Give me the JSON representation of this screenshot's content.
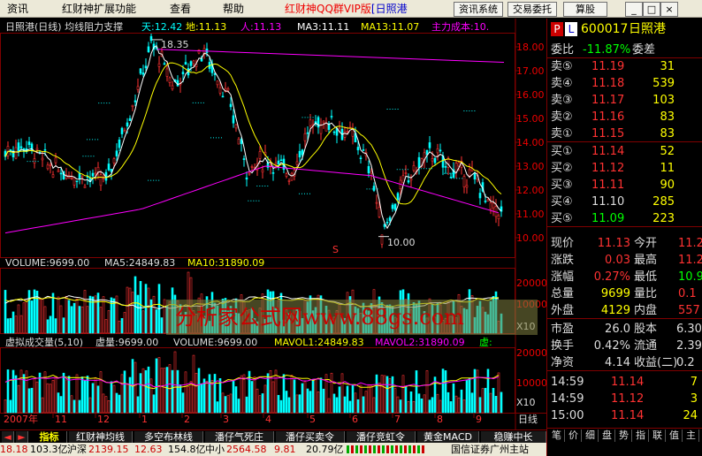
{
  "menu": {
    "items": [
      "资讯",
      "红财神扩展功能",
      "查看",
      "帮助"
    ],
    "brand": "红财神QQ群VIP版",
    "stock_tag": "[日照港"
  },
  "toolbar": {
    "news_system": "资讯系统",
    "trade": "交易委托",
    "calc": "算股",
    "f10": "F10",
    "minimize": "_",
    "maximize": "□",
    "close": "×"
  },
  "price_chart": {
    "title": "日照港(日线) 均线阻力支撑",
    "tian": "天:12.42",
    "di": "地:11.13",
    "ren": "人:11.13",
    "ma3": "MA3:11.11",
    "ma13": "MA13:11.07",
    "cost": "主力成本:10.",
    "high_label": "18.35",
    "low_label": "10.00",
    "marker": "S",
    "yticks": [
      "18.00",
      "17.00",
      "16.00",
      "15.00",
      "14.00",
      "13.00",
      "12.00",
      "11.00",
      "10.00"
    ]
  },
  "volume_chart": {
    "volume": "VOLUME:9699.00",
    "ma5": "MA5:24849.83",
    "ma10": "MA10:31890.09",
    "yticks": [
      "20000",
      "10000"
    ],
    "unit": "X10"
  },
  "virtual_chart": {
    "title": "虚拟成交量(5,10)",
    "xuliang": "虚量:9699.00",
    "volume": "VOLUME:9699.00",
    "mavol1": "MAVOL1:24849.83",
    "mavol2": "MAVOL2:31890.09",
    "xu": "虚:",
    "yticks": [
      "20000",
      "10000"
    ],
    "unit": "X10"
  },
  "xaxis": {
    "year": "2007年",
    "months": [
      "11",
      "12",
      "1",
      "2",
      "3",
      "4",
      "5",
      "6",
      "7",
      "8",
      "9"
    ],
    "period": "日线"
  },
  "tabs": [
    "指标",
    "红财神均线",
    "多空布林线",
    "潘仔气死庄",
    "潘仔买卖令",
    "潘仔竞虹令",
    "黄金MACD",
    "稳赚中长"
  ],
  "status": {
    "idx1_val": "18.18",
    "idx1_chg": "103.3亿",
    "sh": "沪深",
    "sh_val": "2139.15",
    "sh_chg": "12.63",
    "sh_amt": "154.8亿",
    "zx": "中小",
    "zx_val": "2564.58",
    "zx_chg": "9.81",
    "zx_amt": "20.79亿",
    "broker": "国信证券广州主站"
  },
  "quote": {
    "code": "600017",
    "name": "日照港",
    "wei_bi_label": "委比",
    "wei_bi": "-11.87%",
    "wei_cha_label": "委差",
    "sells": [
      {
        "label": "卖⑤",
        "price": "11.19",
        "vol": "31"
      },
      {
        "label": "卖④",
        "price": "11.18",
        "vol": "539"
      },
      {
        "label": "卖③",
        "price": "11.17",
        "vol": "103"
      },
      {
        "label": "卖②",
        "price": "11.16",
        "vol": "83"
      },
      {
        "label": "卖①",
        "price": "11.15",
        "vol": "83"
      }
    ],
    "buys": [
      {
        "label": "买①",
        "price": "11.14",
        "vol": "52"
      },
      {
        "label": "买②",
        "price": "11.12",
        "vol": "11"
      },
      {
        "label": "买③",
        "price": "11.11",
        "vol": "90"
      },
      {
        "label": "买④",
        "price": "11.10",
        "vol": "285"
      },
      {
        "label": "买⑤",
        "price": "11.09",
        "vol": "223"
      }
    ],
    "stats": [
      {
        "l1": "现价",
        "v1": "11.13",
        "l2": "今开",
        "v2": "11.2"
      },
      {
        "l1": "涨跌",
        "v1": "0.03",
        "l2": "最高",
        "v2": "11.2"
      },
      {
        "l1": "涨幅",
        "v1": "0.27%",
        "l2": "最低",
        "v2": "10.9"
      },
      {
        "l1": "总量",
        "v1": "9699",
        "l2": "量比",
        "v2": "0.1"
      },
      {
        "l1": "外盘",
        "v1": "4129",
        "l2": "内盘",
        "v2": "557"
      }
    ],
    "stats2": [
      {
        "l1": "市盈",
        "v1": "26.0",
        "l2": "股本",
        "v2": "6.30"
      },
      {
        "l1": "换手",
        "v1": "0.42%",
        "l2": "流通",
        "v2": "2.39"
      },
      {
        "l1": "净资",
        "v1": "4.14",
        "l2": "收益(二)",
        "v2": "0.2"
      }
    ],
    "ticks": [
      {
        "time": "14:59",
        "price": "11.14",
        "vol": "7"
      },
      {
        "time": "14:59",
        "price": "11.12",
        "vol": "3"
      },
      {
        "time": "15:00",
        "price": "11.14",
        "vol": "24"
      }
    ],
    "bottom_tabs": [
      "笔",
      "价",
      "细",
      "盘",
      "势",
      "指",
      "联",
      "值",
      "主"
    ]
  },
  "watermark": "分析家公式网www.88gs.com",
  "colors": {
    "up": "#ff3232",
    "down": "#00ffff",
    "yellow": "#ffff00",
    "magenta": "#ff00ff",
    "frame": "#800000"
  }
}
